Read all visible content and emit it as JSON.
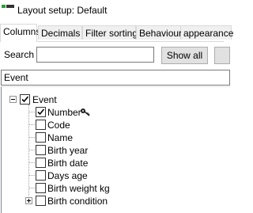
{
  "window": {
    "title": "Layout setup: Default",
    "icon": "app-layout-icon"
  },
  "tabs": [
    {
      "label": "Columns",
      "active": true
    },
    {
      "label": "Decimals",
      "active": false
    },
    {
      "label": "Filter sorting",
      "active": false
    },
    {
      "label": "Behaviour",
      "active": false
    },
    {
      "label": "appearance",
      "active": false
    }
  ],
  "search": {
    "label": "Search",
    "value": "",
    "placeholder": "",
    "show_all_label": "Show all",
    "next_label": ""
  },
  "selector": {
    "value": "Event"
  },
  "tree": {
    "root": {
      "label": "Event",
      "checked": true,
      "expanded": true
    },
    "children": [
      {
        "label": "Number",
        "checked": true,
        "icon": "key-icon"
      },
      {
        "label": "Code",
        "checked": false
      },
      {
        "label": "Name",
        "checked": false
      },
      {
        "label": "Birth year",
        "checked": false
      },
      {
        "label": "Birth date",
        "checked": false
      },
      {
        "label": "Days age",
        "checked": false
      },
      {
        "label": "Birth weight kg",
        "checked": false
      },
      {
        "label": "Birth condition",
        "checked": false,
        "expandable": true
      }
    ]
  },
  "colors": {
    "accent_green": "#2a9d3a",
    "border": "#7a7a7a",
    "button_bg": "#e1e1e1"
  }
}
